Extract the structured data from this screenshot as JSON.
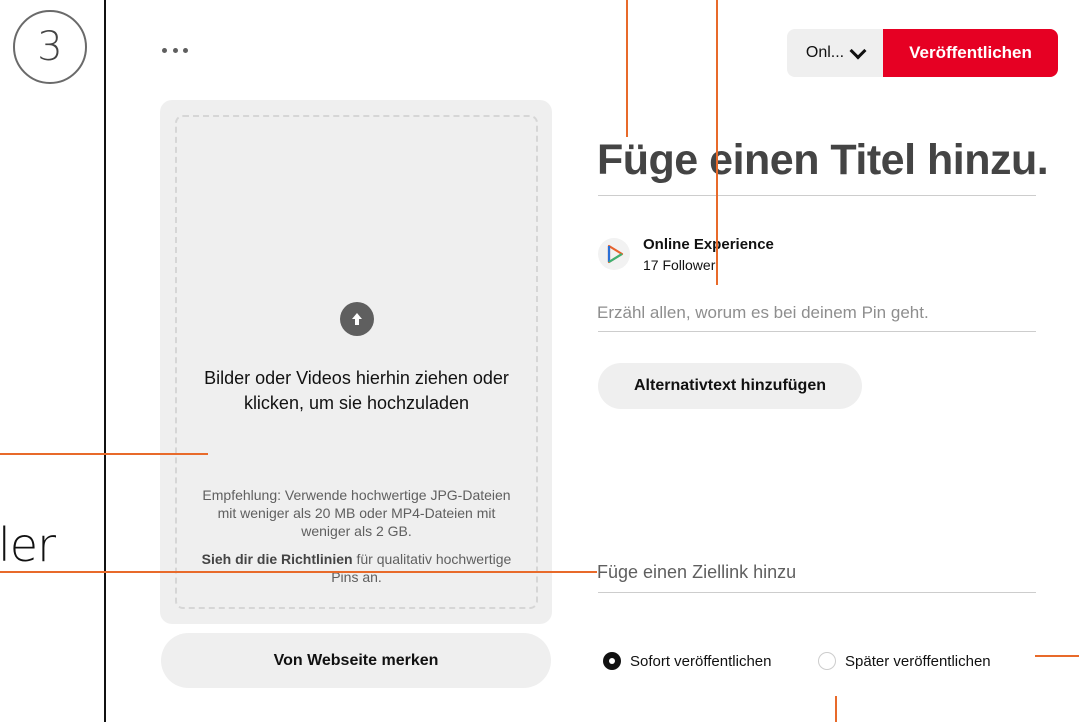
{
  "annotation": {
    "step_number": "3",
    "cut_text": "ler"
  },
  "header": {
    "board_select_label": "Onl...",
    "publish_label": "Veröffentlichen"
  },
  "upload": {
    "instruction": "Bilder oder Videos hierhin ziehen oder klicken, um sie hochzuladen",
    "recommendation": "Empfehlung: Verwende hochwertige JPG-Dateien mit weniger als 20 MB oder MP4-Dateien mit weniger als 2 GB.",
    "guidelines_link": "Sieh dir die Richtlinien",
    "guidelines_rest": " für qualitativ hochwertige Pins an.",
    "save_from_web_label": "Von Webseite merken"
  },
  "form": {
    "title_placeholder": "Füge einen Titel hinzu.",
    "account_name": "Online Experience",
    "account_followers": "17 Follower",
    "description_placeholder": "Erzähl allen, worum es bei deinem Pin geht.",
    "alt_text_label": "Alternativtext hinzufügen",
    "link_placeholder": "Füge einen Ziellink hinzu"
  },
  "publish_options": {
    "now_label": "Sofort veröffentlichen",
    "later_label": "Später veröffentlichen",
    "selected": "now"
  },
  "colors": {
    "brand_red": "#e60023",
    "annotation_orange": "#e86a2a"
  }
}
